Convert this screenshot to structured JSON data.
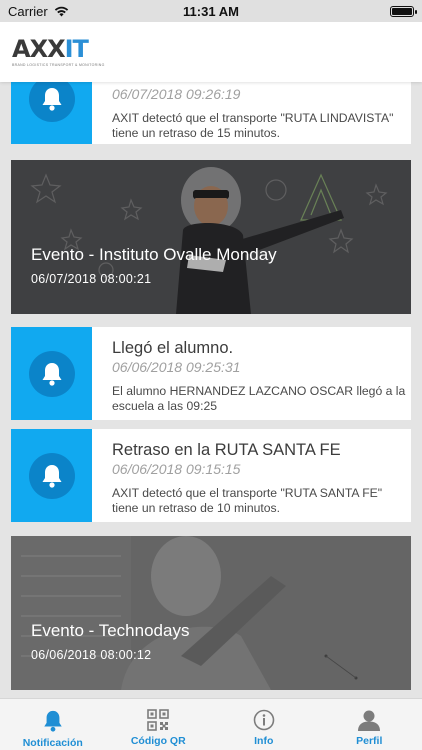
{
  "status_bar": {
    "carrier": "Carrier",
    "time": "11:31 AM",
    "battery_level": 1.0
  },
  "header": {
    "logo_text_a": "AXX",
    "logo_text_b": "IT",
    "logo_tagline": "BRAND LOGISTICS TRANSPORT & MONITORING"
  },
  "notifications": [
    {
      "title": "",
      "date": "06/07/2018 09:26:19",
      "text": "AXIT detectó que el transporte \"RUTA LINDAVISTA\" tiene un retraso de 15 minutos."
    },
    {
      "title": "Llegó el alumno.",
      "date": "06/06/2018 09:25:31",
      "text": "El alumno HERNANDEZ LAZCANO OSCAR llegó a la escuela a las 09:25"
    },
    {
      "title": "Retraso en la RUTA SANTA FE",
      "date": "06/06/2018 09:15:15",
      "text": "AXIT detectó que el transporte \"RUTA SANTA FE\" tiene un retraso de 10 minutos."
    }
  ],
  "events": [
    {
      "title": "Evento - Instituto Ovalle Monday",
      "date": "06/07/2018 08:00:21"
    },
    {
      "title": "Evento - Technodays",
      "date": "06/06/2018 08:00:12"
    }
  ],
  "tabbar": {
    "tabs": [
      {
        "label": "Notificación",
        "icon": "bell-icon",
        "active": true
      },
      {
        "label": "Código QR",
        "icon": "qr-code-icon",
        "active": false
      },
      {
        "label": "Info",
        "icon": "info-icon",
        "active": false
      },
      {
        "label": "Perfil",
        "icon": "user-icon",
        "active": false
      }
    ]
  },
  "colors": {
    "accent": "#11a9f0",
    "accent_dark": "#0b84c9",
    "tab_active": "#1f8ed4"
  }
}
